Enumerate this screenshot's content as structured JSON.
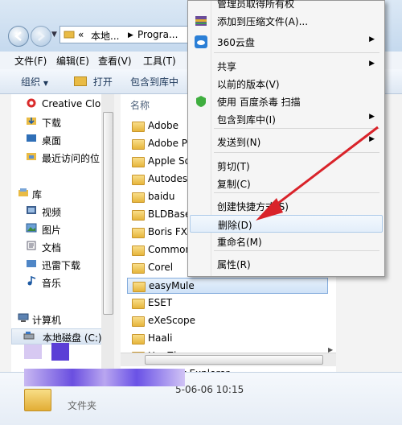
{
  "address": {
    "crumb_prefix": "«",
    "segment_1": "本地...",
    "segment_2": "Progra..."
  },
  "menubar": [
    "文件(F)",
    "编辑(E)",
    "查看(V)",
    "工具(T)"
  ],
  "toolbar": {
    "organize": "组织",
    "open": "打开",
    "include_in_library": "包含到库中"
  },
  "nav": {
    "items": [
      {
        "label": "Creative Clo",
        "icon": "creative-cloud-icon"
      },
      {
        "label": "下载",
        "icon": "download-folder-icon"
      },
      {
        "label": "桌面",
        "icon": "desktop-icon"
      },
      {
        "label": "最近访问的位",
        "icon": "recent-places-icon"
      },
      {
        "label": "库",
        "icon": "library-icon"
      },
      {
        "label": "视频",
        "icon": "video-library-icon"
      },
      {
        "label": "图片",
        "icon": "picture-library-icon"
      },
      {
        "label": "文档",
        "icon": "documents-library-icon"
      },
      {
        "label": "迅雷下载",
        "icon": "xunlei-folder-icon"
      },
      {
        "label": "音乐",
        "icon": "music-library-icon"
      },
      {
        "label": "计算机",
        "icon": "computer-icon"
      },
      {
        "label": "本地磁盘 (C:)",
        "icon": "local-disk-icon"
      }
    ]
  },
  "files": {
    "column_name": "名称",
    "rows": [
      "Adobe",
      "Adobe Pl",
      "Apple So",
      "Autodesk",
      "baidu",
      "BLDBase",
      "Boris FX,",
      "Common",
      "Corel",
      "easyMule",
      "ESET",
      "eXeScope",
      "Haali",
      "HaoZip",
      "Internet Explorer"
    ],
    "selected": "easyMule"
  },
  "details": {
    "date": "5-06-06 10:15",
    "type": "文件夹"
  },
  "context_menu": {
    "items": [
      {
        "label": "管理员取得所有权",
        "submenu": false
      },
      {
        "label": "添加到压缩文件(A)...",
        "submenu": false,
        "icon": "compress-archive-icon"
      },
      {
        "label": "360云盘",
        "submenu": true,
        "icon": "cloud-360-icon"
      },
      {
        "label": "共享",
        "submenu": true
      },
      {
        "label": "以前的版本(V)",
        "submenu": false
      },
      {
        "label": "使用 百度杀毒 扫描",
        "submenu": false,
        "icon": "baidu-antivirus-icon"
      },
      {
        "label": "包含到库中(I)",
        "submenu": true
      },
      {
        "label": "发送到(N)",
        "submenu": true
      },
      {
        "label": "剪切(T)",
        "submenu": false
      },
      {
        "label": "复制(C)",
        "submenu": false
      },
      {
        "label": "创建快捷方式(S)",
        "submenu": false
      },
      {
        "label": "删除(D)",
        "submenu": false
      },
      {
        "label": "重命名(M)",
        "submenu": false
      },
      {
        "label": "属性(R)",
        "submenu": false
      }
    ],
    "highlighted": "删除(D)"
  },
  "colors": {
    "annotation_arrow": "#d9232a",
    "selection_border": "#84acdd",
    "folder": "#e6b53b"
  }
}
